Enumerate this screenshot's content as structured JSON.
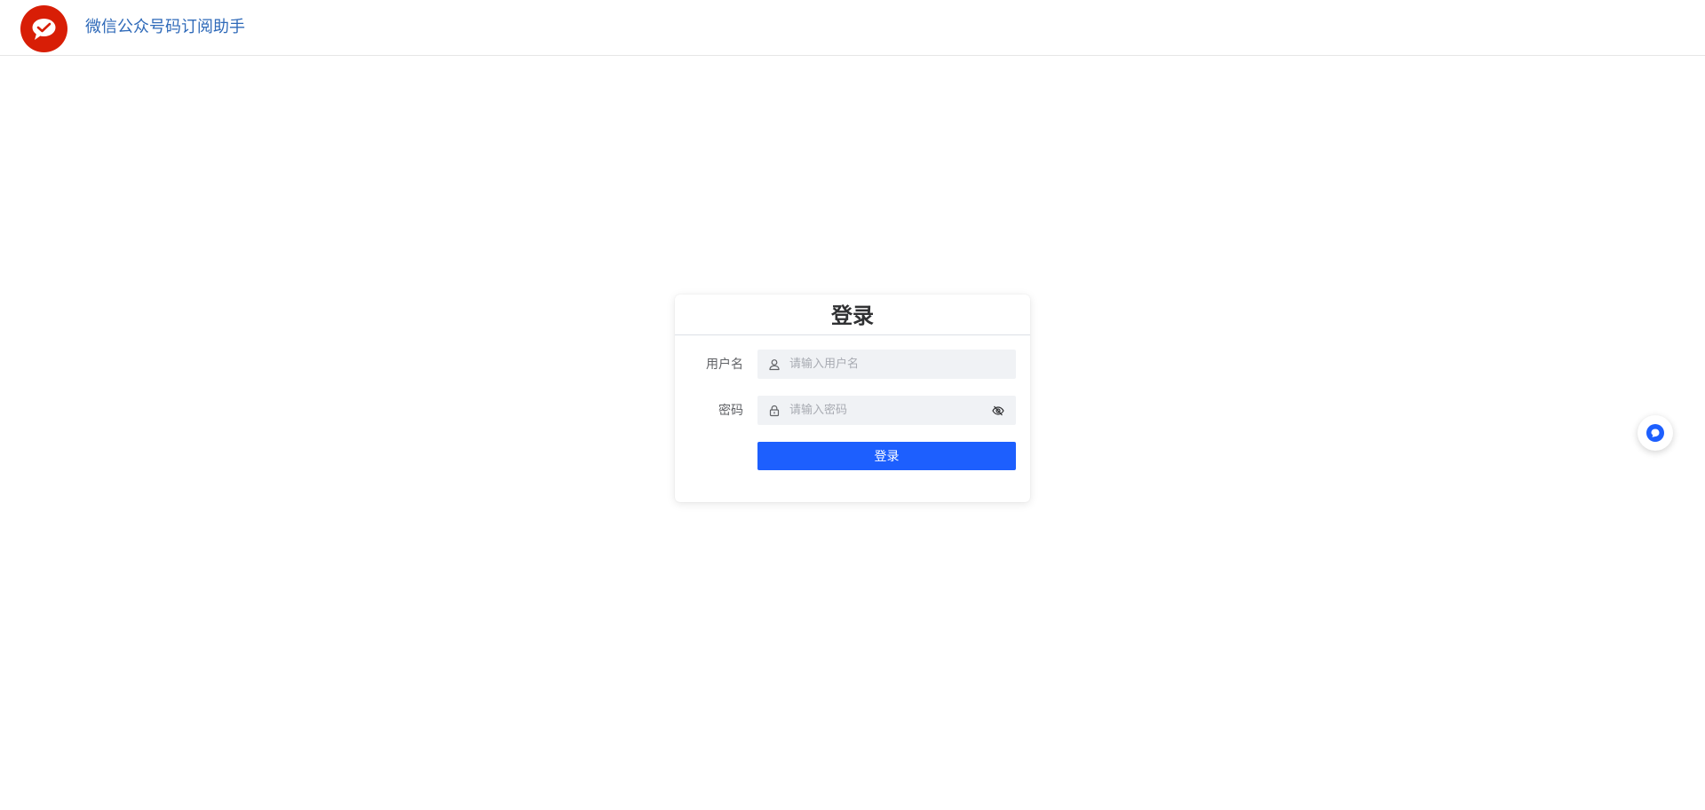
{
  "header": {
    "app_title": "微信公众号码订阅助手",
    "logo_icon": "wechat-logo-icon",
    "logo_color": "#d81e06",
    "title_color": "#2f6ab9"
  },
  "login": {
    "title": "登录",
    "username": {
      "label": "用户名",
      "placeholder": "请输入用户名",
      "value": "",
      "icon": "user-icon"
    },
    "password": {
      "label": "密码",
      "placeholder": "请输入密码",
      "value": "",
      "icon": "lock-icon",
      "toggle_icon": "eye-off-icon"
    },
    "submit_label": "登录",
    "accent_color": "#1d5ffe"
  },
  "floating_button": {
    "icon": "chat-bubble-icon",
    "color": "#1d5ffe"
  }
}
